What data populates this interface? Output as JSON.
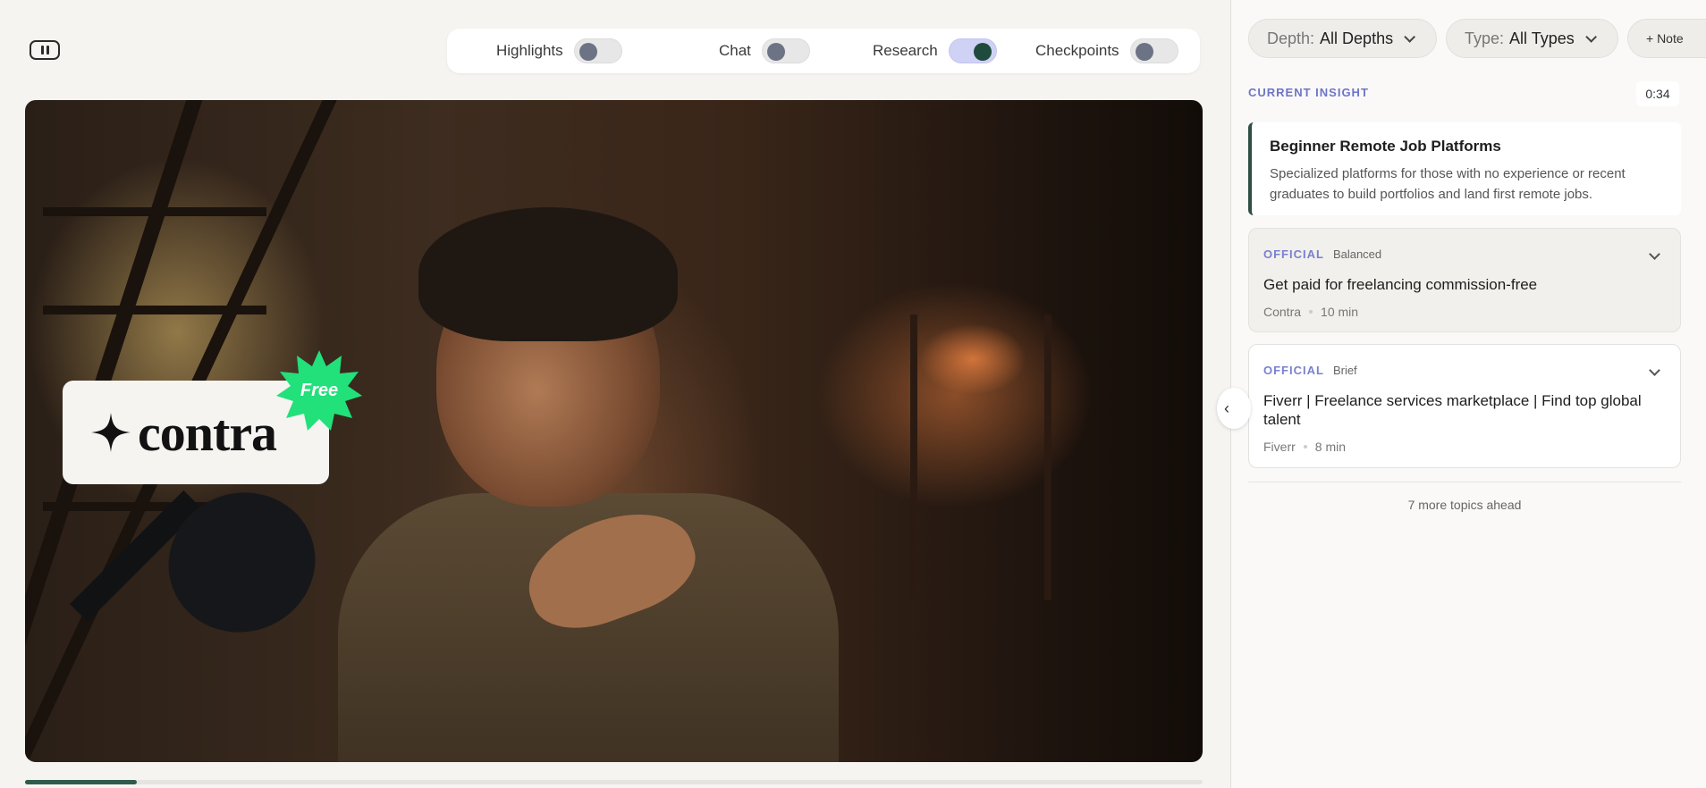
{
  "toggles": [
    {
      "label": "Highlights",
      "on": false
    },
    {
      "label": "Chat",
      "on": false
    },
    {
      "label": "Research",
      "on": true
    },
    {
      "label": "Checkpoints",
      "on": false
    }
  ],
  "video": {
    "logo_text": "contra",
    "free_badge": "Free",
    "progress_fraction": 0.095
  },
  "filters": {
    "depth": {
      "key": "Depth:",
      "value": "All Depths"
    },
    "type": {
      "key": "Type:",
      "value": "All Types"
    },
    "note_label": "+ Note"
  },
  "current_insight": {
    "label": "CURRENT INSIGHT",
    "time": "0:34",
    "title": "Beginner Remote Job Platforms",
    "description": "Specialized platforms for those with no experience or recent graduates to build portfolios and land first remote jobs."
  },
  "cards": [
    {
      "badge": "OFFICIAL",
      "depth": "Balanced",
      "title": "Get paid for freelancing commission-free",
      "source": "Contra",
      "duration": "10 min"
    },
    {
      "badge": "OFFICIAL",
      "depth": "Brief",
      "title": "Fiverr | Freelance services marketplace | Find top global talent",
      "source": "Fiverr",
      "duration": "8 min"
    }
  ],
  "more_topics": "7 more topics ahead",
  "colors": {
    "accent": "#6d74c9",
    "toggle_on_knob": "#1f4b3d",
    "free_badge": "#22e07a",
    "progress": "#2f5a4c"
  }
}
